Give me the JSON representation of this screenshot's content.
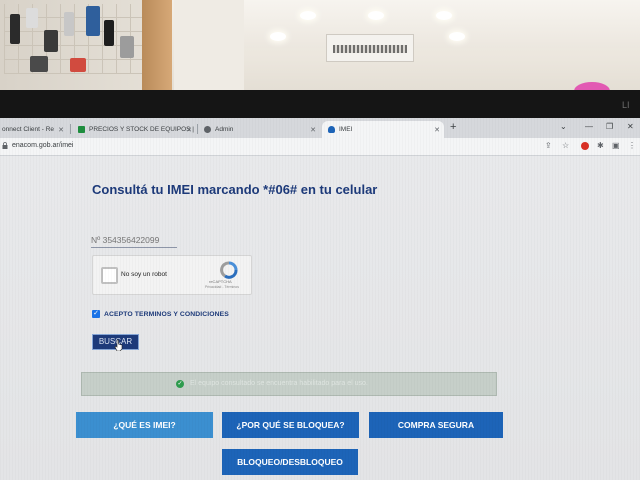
{
  "browser": {
    "tabs": [
      {
        "label": "onnect Client - Re",
        "active": false
      },
      {
        "label": "PRECIOS Y STOCK DE EQUIPOS |",
        "active": false
      },
      {
        "label": "Admin",
        "active": false
      },
      {
        "label": "IMEI",
        "active": true
      }
    ],
    "new_tab": "+",
    "url": "enacom.gob.ar/imei"
  },
  "page": {
    "headline": "Consultá tu IMEI marcando *#06# en tu celular",
    "imei_input": {
      "value": "",
      "placeholder": "Nº 354356422099"
    },
    "captcha": {
      "label": "No soy un robot",
      "brand": "reCAPTCHA",
      "terms": "Privacidad - Términos"
    },
    "terms_label": "ACEPTO TERMINOS Y CONDICIONES",
    "terms_checked": true,
    "search_button": "BUSCAR",
    "status_message": "El equipo consultado se encuentra habilitado para el uso.",
    "buttons": {
      "what_is_imei": "¿QUÉ ES IMEI?",
      "why_blocked": "¿POR QUÉ SE BLOQUEA?",
      "safe_purchase": "COMPRA SEGURA",
      "block_unblock": "BLOQUEO/DESBLOQUEO"
    }
  },
  "monitor_brand": "LI",
  "colors": {
    "headline": "#1d3a7a",
    "button_primary": "#1d64b8",
    "button_light": "#3b8fd0",
    "status_bg": "#c6cfc9"
  }
}
